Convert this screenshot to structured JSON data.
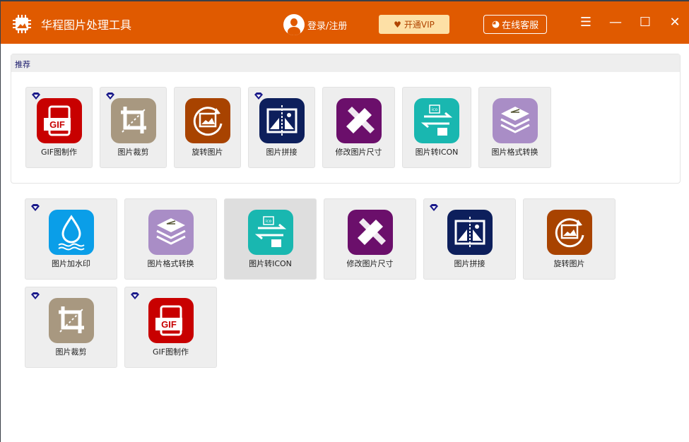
{
  "header": {
    "title": "华程图片处理工具",
    "login": "登录/注册",
    "vip": "开通VIP",
    "service": "在线客服"
  },
  "recommend": {
    "title": "推荐",
    "tiles": [
      {
        "label": "GIF图制作",
        "icon": "gif",
        "vip": true
      },
      {
        "label": "图片裁剪",
        "icon": "crop",
        "vip": true
      },
      {
        "label": "旋转图片",
        "icon": "rotate",
        "vip": false
      },
      {
        "label": "图片拼接",
        "icon": "stitch",
        "vip": true
      },
      {
        "label": "修改图片尺寸",
        "icon": "resize",
        "vip": false
      },
      {
        "label": "图片转ICON",
        "icon": "ico",
        "vip": false
      },
      {
        "label": "图片格式转换",
        "icon": "format",
        "vip": false
      }
    ]
  },
  "tools": [
    {
      "label": "图片加水印",
      "icon": "water",
      "vip": true
    },
    {
      "label": "图片格式转换",
      "icon": "format",
      "vip": false
    },
    {
      "label": "图片转ICON",
      "icon": "ico",
      "vip": false,
      "selected": true
    },
    {
      "label": "修改图片尺寸",
      "icon": "resize",
      "vip": false
    },
    {
      "label": "图片拼接",
      "icon": "stitch",
      "vip": true
    },
    {
      "label": "旋转图片",
      "icon": "rotate",
      "vip": false
    },
    {
      "label": "图片裁剪",
      "icon": "crop",
      "vip": true
    },
    {
      "label": "GIF图制作",
      "icon": "gif",
      "vip": true
    }
  ],
  "colors": {
    "gif": "#c80000",
    "crop": "#a89880",
    "rotate": "#a84300",
    "stitch": "#0d1f5c",
    "resize": "#6b0f6b",
    "ico": "#19b7b0",
    "format": "#a98dc6",
    "water": "#0a9ee8",
    "header": "#e05a00"
  }
}
